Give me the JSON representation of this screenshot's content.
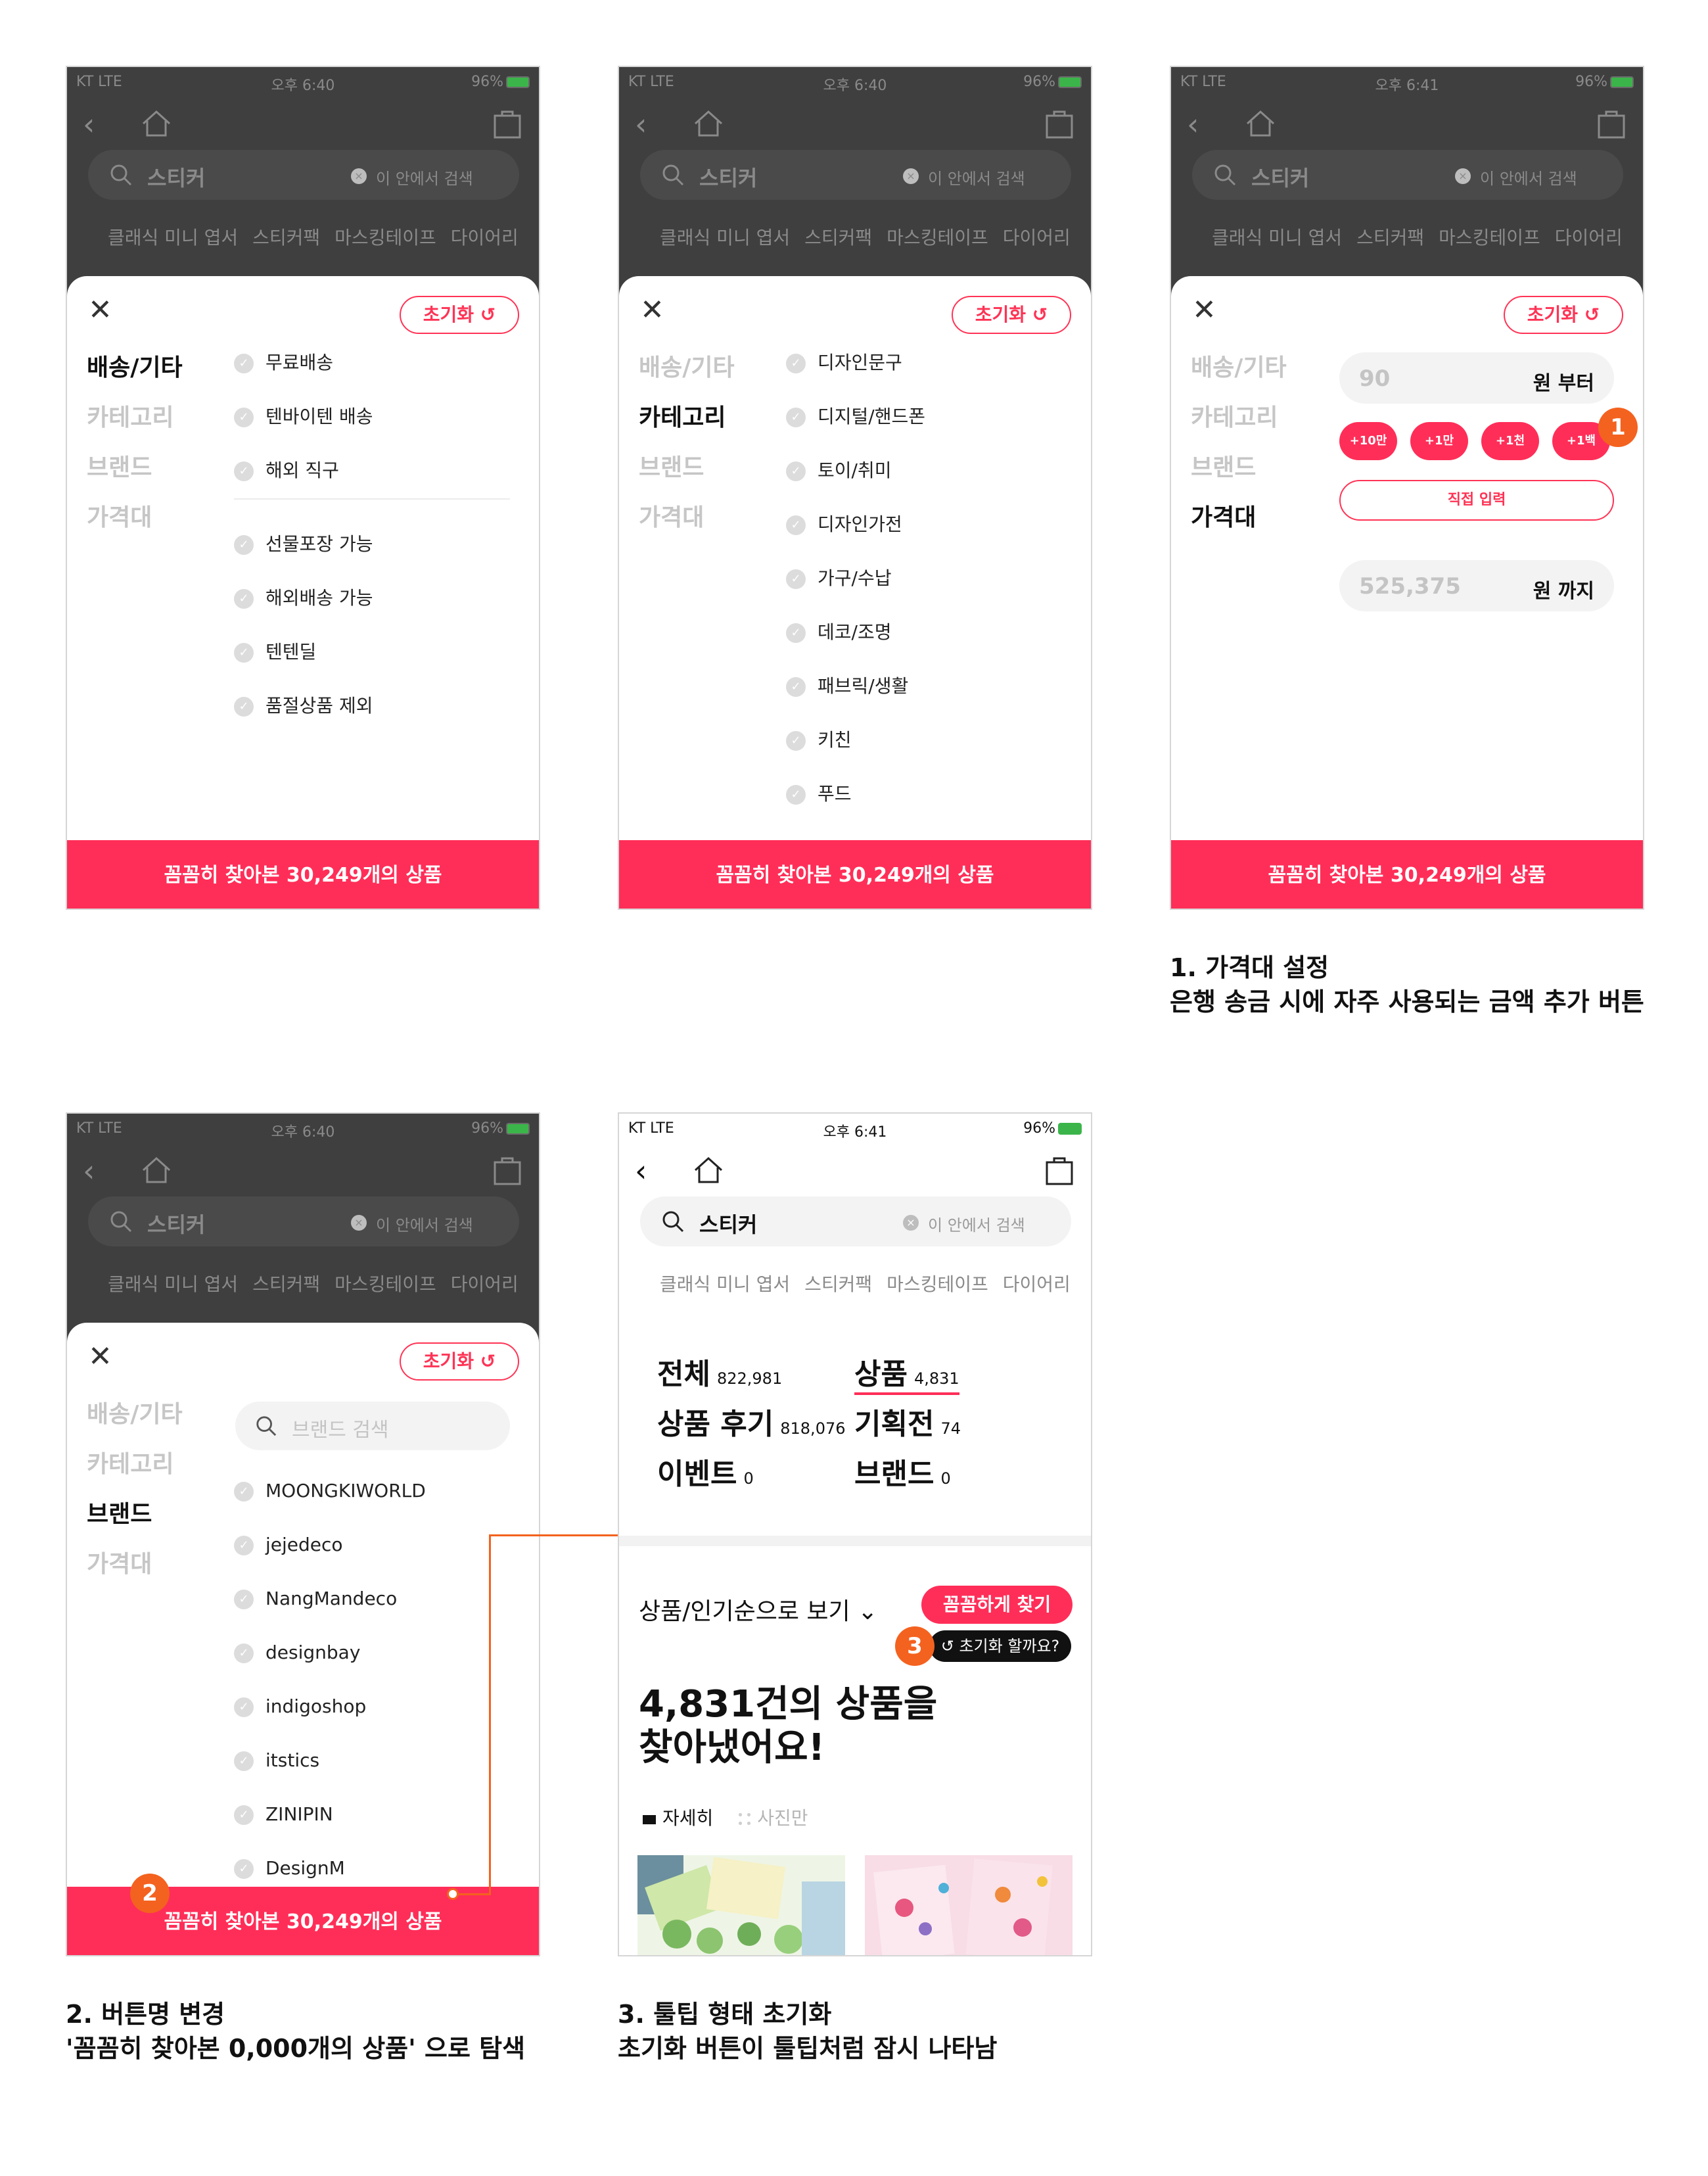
{
  "status": {
    "carrier": "KT  LTE",
    "time_640": "오후 6:40",
    "time_641": "오후 6:41",
    "battery": "96%"
  },
  "search": {
    "term": "스티커",
    "scope_placeholder": "이 안에서 검색"
  },
  "related_keywords": [
    "클래식 미니 엽서",
    "스티커팩",
    "마스킹테이프",
    "다이어리"
  ],
  "filter": {
    "reset_label": "초기화 ↺",
    "close_icon": "close-icon",
    "categories": [
      "배송/기타",
      "카테고리",
      "브랜드",
      "가격대"
    ],
    "result_label": "꼼꼼히 찾아본 30,249개의 상품"
  },
  "screen1": {
    "options_top": [
      "무료배송",
      "텐바이텐 배송",
      "해외 직구"
    ],
    "options_bottom": [
      "선물포장 가능",
      "해외배송 가능",
      "텐텐딜",
      "품절상품 제외"
    ]
  },
  "screen2": {
    "options": [
      "디자인문구",
      "디지털/핸드폰",
      "토이/취미",
      "디자인가전",
      "가구/수납",
      "데코/조명",
      "패브릭/생활",
      "키친",
      "푸드"
    ]
  },
  "screen3": {
    "min_value": "90",
    "min_unit": "원 부터",
    "amount_buttons": [
      "+10만",
      "+1만",
      "+1천",
      "+1백"
    ],
    "direct_input": "직접 입력",
    "max_value": "525,375",
    "max_unit": "원 까지",
    "badge": "1"
  },
  "screen4": {
    "brand_search_placeholder": "브랜드 검색",
    "brands": [
      "MOONGKIWORLD",
      "jejedeco",
      "NangMandeco",
      "designbay",
      "indigoshop",
      "itstics",
      "ZINIPIN",
      "DesignM"
    ],
    "badge": "2"
  },
  "screen5": {
    "tabs": [
      {
        "label": "전체",
        "count": "822,981"
      },
      {
        "label": "상품",
        "count": "4,831"
      },
      {
        "label": "상품 후기",
        "count": "818,076"
      },
      {
        "label": "기획전",
        "count": "74"
      },
      {
        "label": "이벤트",
        "count": "0"
      },
      {
        "label": "브랜드",
        "count": "0"
      }
    ],
    "sort_label": "상품/인기순으로 보기",
    "find_button": "꼼꼼하게 찾기",
    "tooltip": "↺ 초기화 할까요?",
    "headline_line1": "4,831건의 상품을",
    "headline_line2": "찾아냈어요!",
    "view_detail": "자세히",
    "view_photo": "사진만",
    "badge": "3"
  },
  "captions": {
    "c1_title": "1. 가격대 설정",
    "c1_body": "은행 송금 시에 자주 사용되는 금액 추가 버튼",
    "c2_title": "2. 버튼명 변경",
    "c2_body": "'꼼꼼히 찾아본 0,000개의 상품' 으로 탐색",
    "c3_title": "3. 툴팁 형태 초기화",
    "c3_body": "초기화 버튼이 툴팁처럼 잠시 나타남"
  },
  "colors": {
    "accent": "#ff2e58",
    "badge": "#f4621f",
    "dim_header": "#3f3f3f"
  }
}
